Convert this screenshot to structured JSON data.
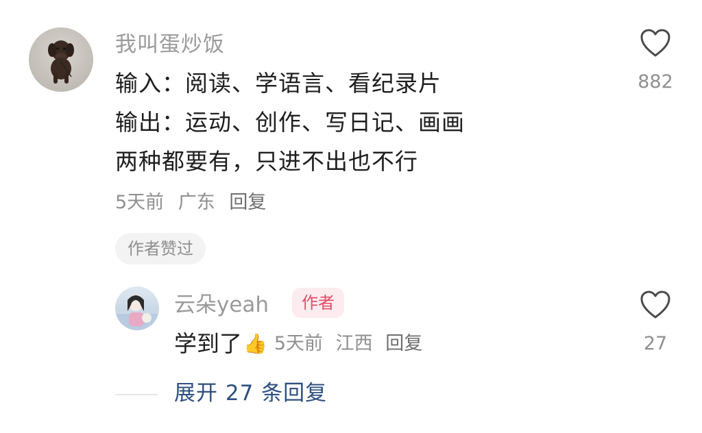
{
  "comment": {
    "username": "我叫蛋炒饭",
    "lines": [
      "输入：阅读、学语言、看纪录片",
      "输出：运动、创作、写日记、画画",
      "两种都要有，只进不出也不行"
    ],
    "time": "5天前",
    "location": "广东",
    "reply_label": "回复",
    "liked_by_author": "作者赞过",
    "like_count": "882"
  },
  "reply": {
    "username": "云朵yeah",
    "author_tag": "作者",
    "text": "学到了",
    "emoji": "👍",
    "time": "5天前",
    "location": "江西",
    "reply_label": "回复",
    "like_count": "27"
  },
  "expand_label": "展开 27 条回复",
  "colors": {
    "link": "#2d4f7e",
    "author_tag_bg": "#fdecef",
    "author_tag_text": "#e04d68"
  },
  "icons": {
    "like": "heart-outline-icon",
    "avatar_main": "dog-avatar",
    "avatar_reply": "cartoon-girl-avatar"
  }
}
